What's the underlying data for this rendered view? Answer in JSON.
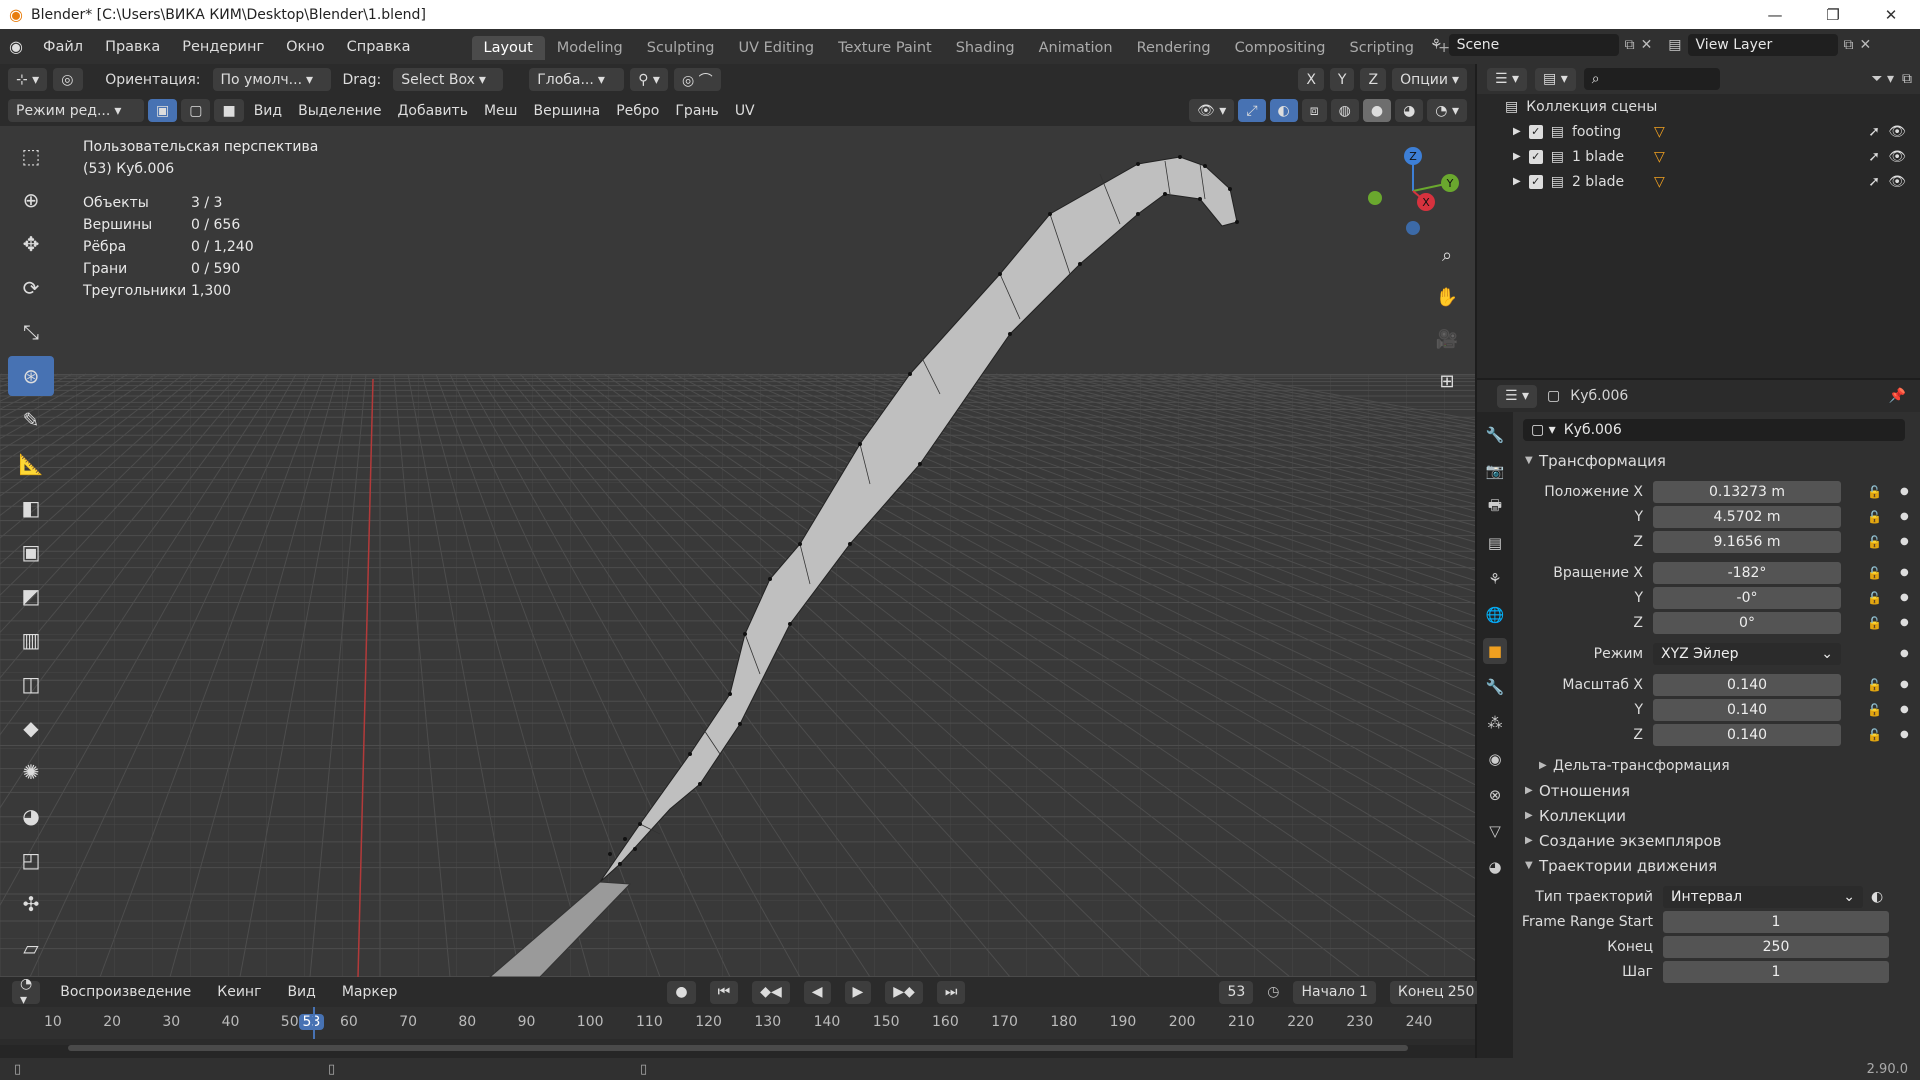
{
  "window": {
    "title": "Blender* [C:\\Users\\ВИКА КИМ\\Desktop\\Blender\\1.blend]",
    "minimize": "—",
    "maximize": "❐",
    "close": "✕"
  },
  "menu": [
    "Файл",
    "Правка",
    "Рендеринг",
    "Окно",
    "Справка"
  ],
  "workspaces": [
    "Layout",
    "Modeling",
    "Sculpting",
    "UV Editing",
    "Texture Paint",
    "Shading",
    "Animation",
    "Rendering",
    "Compositing",
    "Scripting"
  ],
  "add_workspace": "+",
  "scene": "Scene",
  "view_layer": "View Layer",
  "vp_header1": {
    "orientation_label": "Ориентация:",
    "orientation_value": "По умолч...",
    "drag_label": "Drag:",
    "drag_value": "Select Box",
    "pivot_value": "Глоба...",
    "axes": [
      "X",
      "Y",
      "Z"
    ],
    "options": "Опции"
  },
  "vp_header2": {
    "mode": "Режим ред...",
    "menus": [
      "Вид",
      "Выделение",
      "Добавить",
      "Меш",
      "Вершина",
      "Ребро",
      "Грань",
      "UV"
    ]
  },
  "overlay": {
    "view_name": "Пользовательская перспектива",
    "object_name": "(53) Куб.006",
    "stats": [
      {
        "k": "Объекты",
        "v": "3 / 3"
      },
      {
        "k": "Вершины",
        "v": "0 / 656"
      },
      {
        "k": "Рёбра",
        "v": "0 / 1,240"
      },
      {
        "k": "Грани",
        "v": "0 / 590"
      },
      {
        "k": "Треугольники",
        "v": "1,300"
      }
    ]
  },
  "gizmo": {
    "x": "X",
    "y": "Y",
    "z": "Z"
  },
  "timeline": {
    "menus": [
      "Воспроизведение",
      "Кеинг",
      "Вид",
      "Маркер"
    ],
    "current_frame": "53",
    "start_label": "Начало",
    "start_value": "1",
    "end_label": "Конец",
    "end_value": "250",
    "ticks": [
      "10",
      "20",
      "30",
      "40",
      "50",
      "53",
      "60",
      "70",
      "80",
      "90",
      "100",
      "110",
      "120",
      "130",
      "140",
      "150",
      "160",
      "170",
      "180",
      "190",
      "200",
      "210",
      "220",
      "230",
      "240"
    ]
  },
  "outliner": {
    "root": "Коллекция сцены",
    "items": [
      {
        "name": "footing"
      },
      {
        "name": "1 blade"
      },
      {
        "name": "2 blade"
      }
    ]
  },
  "properties": {
    "header_object": "Куб.006",
    "name_field": "Куб.006",
    "transform_title": "Трансформация",
    "location": {
      "label": "Положение X",
      "x": "0.13273 m",
      "y": "4.5702 m",
      "z": "9.1656 m"
    },
    "rotation": {
      "label": "Вращение X",
      "x": "-182°",
      "y": "-0°",
      "z": "0°"
    },
    "mode_label": "Режим",
    "mode_value": "XYZ Эйлер",
    "scale": {
      "label": "Масштаб X",
      "x": "0.140",
      "y": "0.140",
      "z": "0.140"
    },
    "axis_y": "Y",
    "axis_z": "Z",
    "delta": "Дельта-трансформация",
    "sections": [
      "Отношения",
      "Коллекции",
      "Создание экземпляров"
    ],
    "motion_paths": "Траектории движения",
    "path_type_label": "Тип траекторий",
    "path_type_value": "Интервал",
    "frame_range_start_label": "Frame Range Start",
    "frame_range_start_value": "1",
    "end_label": "Конец",
    "end_value": "250",
    "step_label": "Шаг",
    "step_value": "1"
  },
  "version": "2.90.0"
}
